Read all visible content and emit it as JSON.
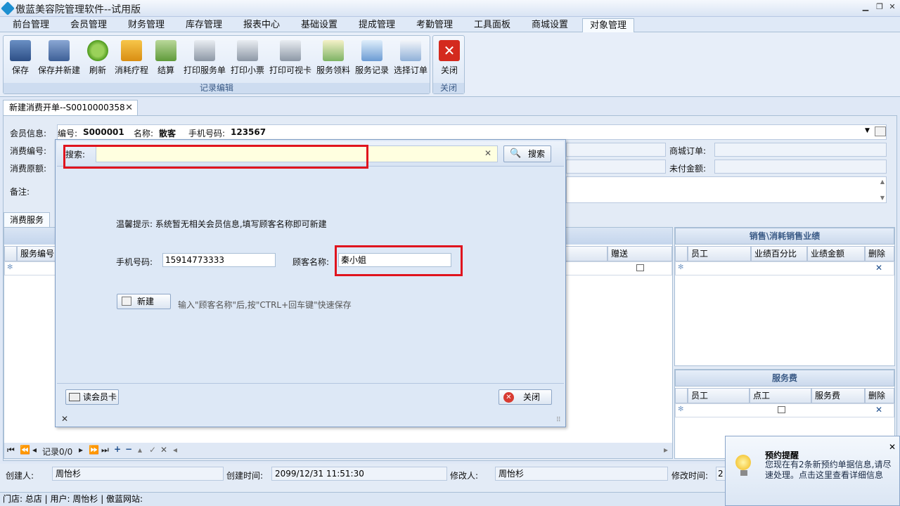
{
  "window": {
    "title": "傲蓝美容院管理软件--试用版"
  },
  "menu": {
    "tabs": [
      "前台管理",
      "会员管理",
      "财务管理",
      "库存管理",
      "报表中心",
      "基础设置",
      "提成管理",
      "考勤管理",
      "工具面板",
      "商城设置",
      "对象管理"
    ],
    "active": "对象管理"
  },
  "ribbon": {
    "record_group": {
      "caption": "记录编辑",
      "buttons": [
        "保存",
        "保存并新建",
        "刷新",
        "消耗疗程",
        "结算",
        "打印服务单",
        "打印小票",
        "打印可视卡",
        "服务领料",
        "服务记录",
        "选择订单"
      ]
    },
    "close_group": {
      "caption": "关闭",
      "button": "关闭"
    }
  },
  "doc_tab": {
    "label": "新建消费开单--S0010000358"
  },
  "form": {
    "member_label": "会员信息:",
    "member_info": {
      "no_label": "编号:",
      "no": "S000001",
      "name_label": "名称:",
      "name": "散客",
      "phone_label": "手机号码:",
      "phone": "123567"
    },
    "consume_no_label": "消费编号:",
    "original_amount_label": "消费原额:",
    "remark_label": "备注:",
    "mall_order_label": "商城订单:",
    "unpaid_label": "未付金额:"
  },
  "tabs": {
    "service": "消费服务"
  },
  "service_grid": {
    "columns": [
      "服务编号",
      "赠送"
    ]
  },
  "sales_panel": {
    "title": "销售\\消耗销售业绩",
    "columns": [
      "员工",
      "业绩百分比",
      "业绩金额",
      "删除"
    ]
  },
  "fee_panel": {
    "title": "服务费",
    "columns": [
      "员工",
      "点工",
      "服务费",
      "删除"
    ]
  },
  "navigator": {
    "record": "记录0/0"
  },
  "footer": {
    "creator_label": "创建人:",
    "creator": "周怡杉",
    "created_time_label": "创建时间:",
    "created_time": "2099/12/31 11:51:30",
    "modifier_label": "修改人:",
    "modifier": "周怡杉",
    "modified_time_label": "修改时间:",
    "modified_time": "2"
  },
  "status": {
    "text": "门店: 总店  | 用户: 周怡杉  | 傲蓝网站:"
  },
  "dialog": {
    "search_label": "搜索:",
    "search_value": "",
    "search_button": "搜索",
    "tip": "温馨提示: 系统暂无相关会员信息,填写顾客名称即可新建",
    "phone_label": "手机号码:",
    "phone_value": "15914773333",
    "customer_label": "顾客名称:",
    "customer_value": "秦小姐",
    "new_button": "新建",
    "new_hint": "输入\"顾客名称\"后,按\"CTRL+回车键\"快速保存",
    "read_card_button": "读会员卡",
    "close_button": "关闭"
  },
  "notification": {
    "title": "预约提醒",
    "body": "您现在有2条新预约单据信息,请尽速处理。点击这里查看详细信息"
  },
  "colors": {
    "highlight_box": "#e0141e",
    "search_bg": "#ffffe0",
    "panel_title": "#3a5a86"
  }
}
